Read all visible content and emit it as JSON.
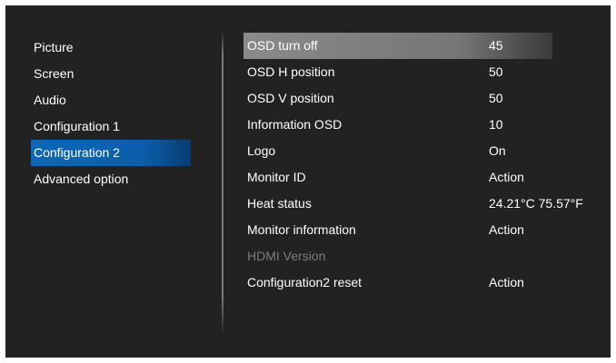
{
  "menu": {
    "items": [
      {
        "label": "Picture"
      },
      {
        "label": "Screen"
      },
      {
        "label": "Audio"
      },
      {
        "label": "Configuration 1"
      },
      {
        "label": "Configuration 2"
      },
      {
        "label": "Advanced option"
      }
    ],
    "active_index": 4
  },
  "settings": {
    "rows": [
      {
        "label": "OSD turn off",
        "value": "45"
      },
      {
        "label": "OSD H position",
        "value": "50"
      },
      {
        "label": "OSD V position",
        "value": "50"
      },
      {
        "label": "Information OSD",
        "value": "10"
      },
      {
        "label": "Logo",
        "value": "On"
      },
      {
        "label": "Monitor ID",
        "value": "Action"
      },
      {
        "label": "Heat status",
        "value": "24.21°C 75.57°F"
      },
      {
        "label": "Monitor information",
        "value": "Action"
      },
      {
        "label": "HDMI Version",
        "value": ""
      },
      {
        "label": "Configuration2 reset",
        "value": "Action"
      }
    ],
    "selected_index": 0,
    "disabled_index": 8
  },
  "colors": {
    "background": "#222222",
    "menu_highlight": "#0d67b6",
    "row_highlight": "#8a8a8a",
    "disabled_text": "#7c7c7c"
  }
}
